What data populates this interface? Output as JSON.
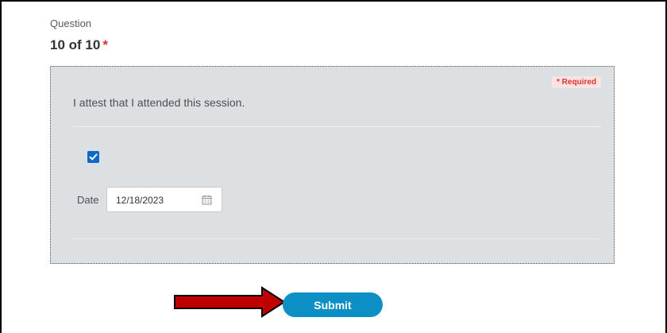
{
  "question": {
    "label": "Question",
    "count": "10 of 10",
    "required_marker": "*"
  },
  "panel": {
    "required_badge": "* Required",
    "prompt": "I attest that I attended this session.",
    "checkbox_checked": true,
    "date_label": "Date",
    "date_value": "12/18/2023"
  },
  "actions": {
    "submit_label": "Submit"
  },
  "colors": {
    "accent": "#0b8fc4",
    "checkbox": "#0b69c7",
    "required": "#d9342b",
    "arrow": "#c00000",
    "panel_bg": "#dde0e3"
  },
  "icons": {
    "checkbox": "checkmark-icon",
    "date": "calendar-icon",
    "pointer": "arrow-right-icon"
  }
}
